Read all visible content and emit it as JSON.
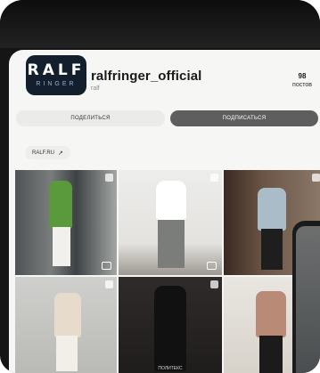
{
  "profile": {
    "avatar_main": "RALF",
    "avatar_sub": "RINGER",
    "username": "ralfringer_official",
    "handle": "ralf"
  },
  "stats": {
    "posts_value": "98",
    "posts_label": "постов"
  },
  "actions": {
    "share_label": "ПОДЕЛИТЬСЯ",
    "subscribe_label": "ПОДПИСАТЬСЯ"
  },
  "link": {
    "label": "RALF.RU"
  },
  "grid": {
    "tile5_caption": "ПОЛИТЕКС"
  }
}
